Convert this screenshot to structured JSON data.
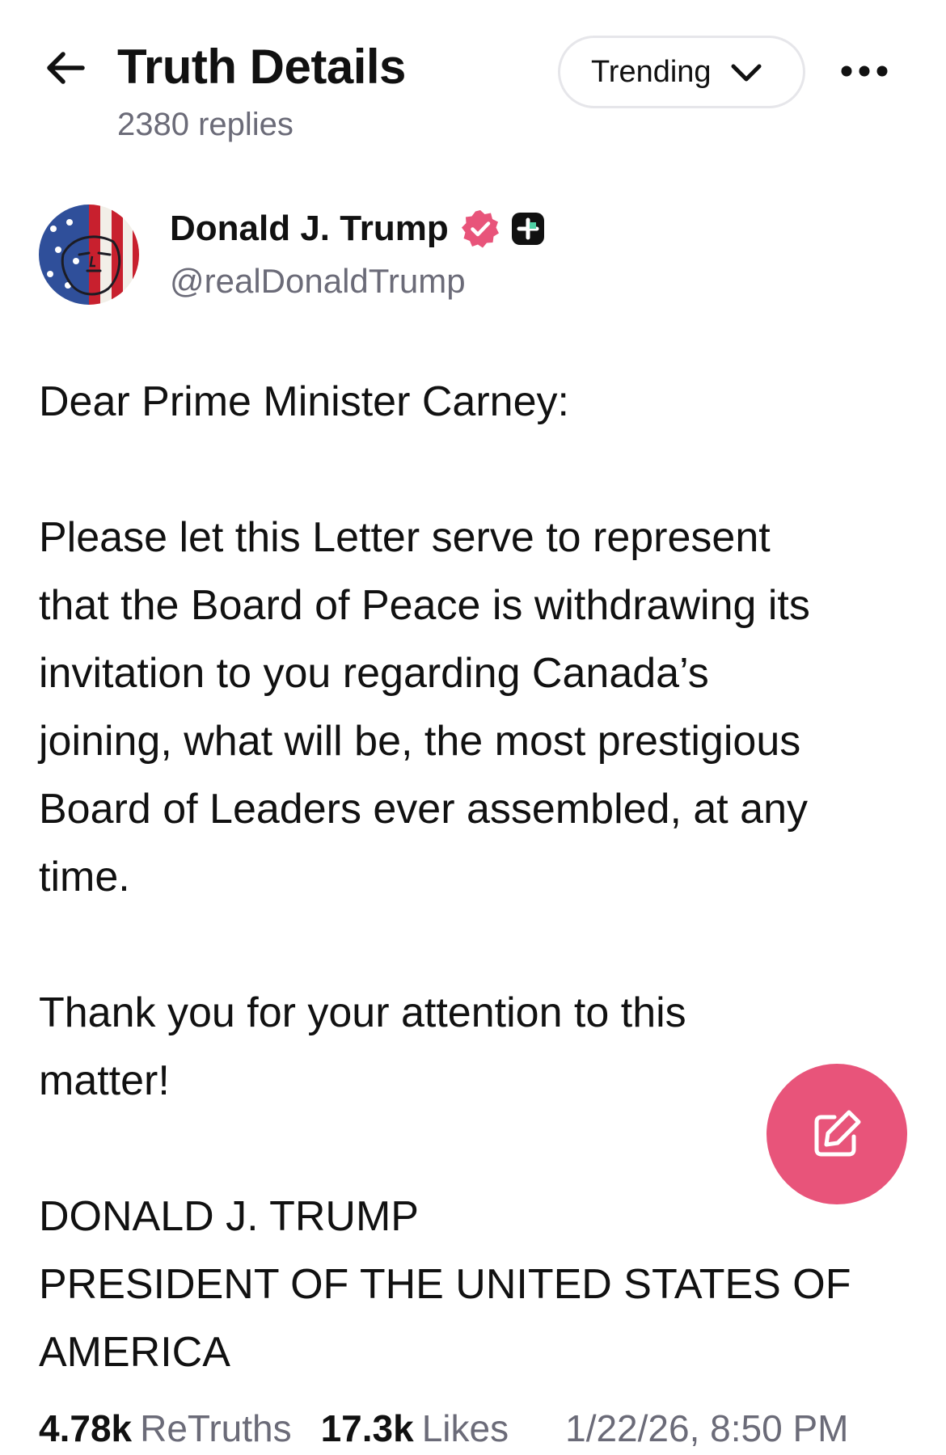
{
  "header": {
    "title": "Truth Details",
    "reply_count": "2380 replies",
    "sort_label": "Trending",
    "back_icon": "arrow-left-icon",
    "more_icon": "more-horizontal-icon"
  },
  "author": {
    "name": "Donald J. Trump",
    "handle": "@realDonaldTrump",
    "verified_color": "#e8547a"
  },
  "post": {
    "paragraphs": [
      [
        "Dear Prime Minister Carney:"
      ],
      [
        "Please let this Letter serve to represent",
        "that the Board of Peace is withdrawing its",
        "invitation to you regarding Canada’s",
        "joining, what will be, the most prestigious",
        "Board of Leaders ever assembled, at any",
        "time."
      ],
      [
        "Thank you for your attention to this",
        "matter!"
      ],
      [
        "DONALD J. TRUMP",
        "PRESIDENT OF THE UNITED STATES OF",
        "AMERICA"
      ]
    ]
  },
  "stats": {
    "retruths_count": "4.78k",
    "retruths_label": "ReTruths",
    "likes_count": "17.3k",
    "likes_label": "Likes",
    "timestamp": "1/22/26, 8:50 PM"
  },
  "compose": {
    "icon": "compose-edit-icon",
    "color": "#e8547a"
  }
}
